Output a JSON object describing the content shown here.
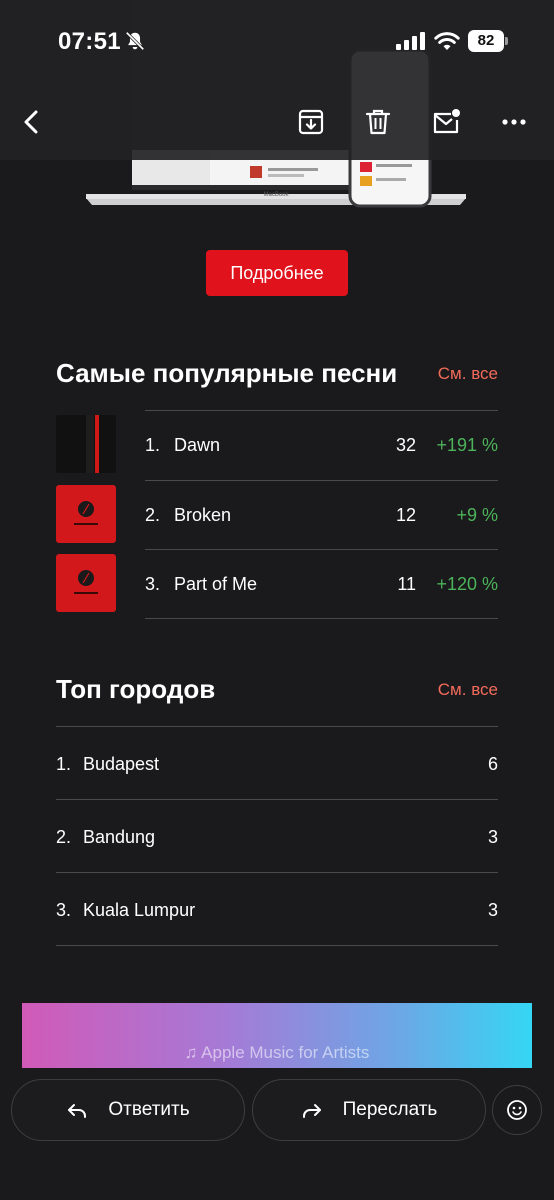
{
  "status_bar": {
    "time": "07:51",
    "battery": "82"
  },
  "toolbar": {
    "icons": [
      "back-icon",
      "archive-icon",
      "trash-icon",
      "mail-unread-icon",
      "more-icon"
    ]
  },
  "hero": {
    "laptop_label": "MacBook"
  },
  "promo": {
    "button_label": "Подробнее"
  },
  "top_songs": {
    "title": "Самые популярные песни",
    "see_all": "См. все",
    "items": [
      {
        "num": "1.",
        "name": "Dawn",
        "count": "32",
        "change": "+191 %"
      },
      {
        "num": "2.",
        "name": "Broken",
        "count": "12",
        "change": "+9 %"
      },
      {
        "num": "3.",
        "name": "Part of Me",
        "count": "11",
        "change": "+120 %"
      }
    ]
  },
  "top_cities": {
    "title": "Топ городов",
    "see_all": "См. все",
    "items": [
      {
        "num": "1.",
        "name": "Budapest",
        "count": "6"
      },
      {
        "num": "2.",
        "name": "Bandung",
        "count": "3"
      },
      {
        "num": "3.",
        "name": "Kuala Lumpur",
        "count": "3"
      }
    ]
  },
  "banner": {
    "text": "♫ Apple Music for Artists"
  },
  "actions": {
    "reply": "Ответить",
    "forward": "Переслать"
  },
  "colors": {
    "background": "#1a1a1c",
    "accent_red": "#e0121c",
    "see_all": "#f26b5b",
    "positive_change": "#4cb35a"
  }
}
